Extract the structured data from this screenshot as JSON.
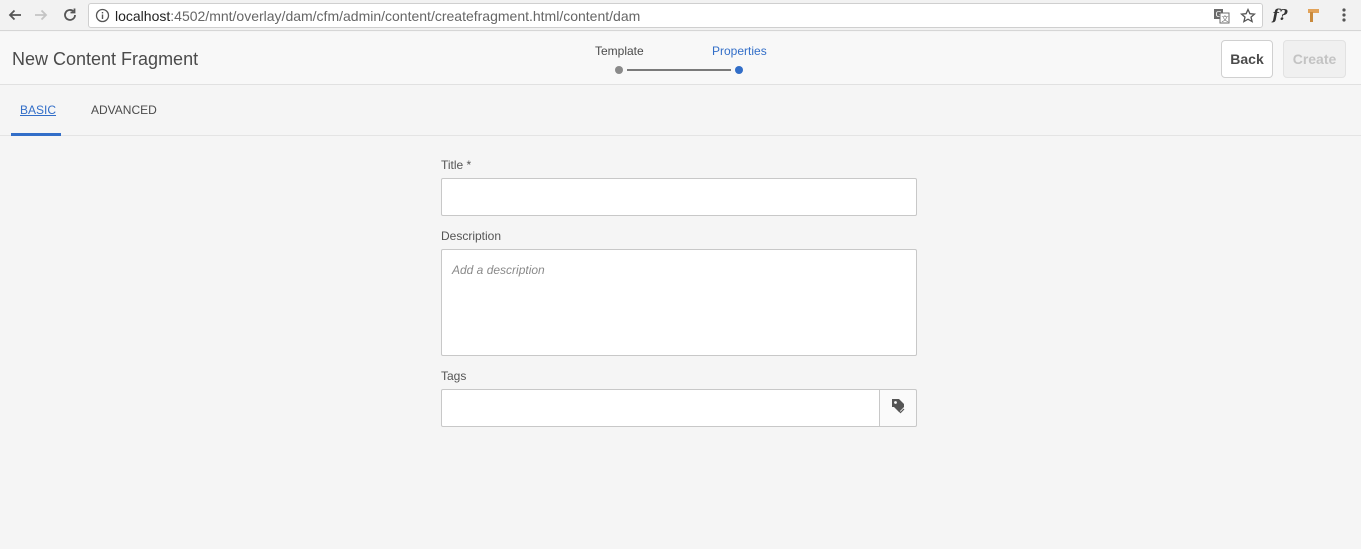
{
  "browser": {
    "url_host": "localhost",
    "url_path": ":4502/mnt/overlay/dam/cfm/admin/content/createfragment.html/content/dam",
    "icons": [
      "back-arrow-icon",
      "forward-arrow-icon",
      "reload-icon",
      "info-icon",
      "translate-icon",
      "star-icon",
      "function-extension-icon",
      "hammer-extension-icon",
      "more-vert-icon"
    ],
    "ext_function_label": "f?"
  },
  "header": {
    "title": "New Content Fragment",
    "wizard": {
      "steps": [
        {
          "label": "Template",
          "state": "done"
        },
        {
          "label": "Properties",
          "state": "active"
        }
      ]
    },
    "back_label": "Back",
    "create_label": "Create",
    "create_enabled": false
  },
  "tabs": [
    {
      "label": "BASIC",
      "active": true
    },
    {
      "label": "ADVANCED",
      "active": false
    }
  ],
  "form": {
    "title": {
      "label": "Title *",
      "value": ""
    },
    "description": {
      "label": "Description",
      "placeholder": "Add a description",
      "value": ""
    },
    "tags": {
      "label": "Tags",
      "value": "",
      "picker_icon": "tag-icon"
    }
  },
  "colors": {
    "accent": "#326ec8",
    "background": "#f5f5f5",
    "text": "#4b4b4b",
    "disabled_text": "#c3c3c3"
  }
}
